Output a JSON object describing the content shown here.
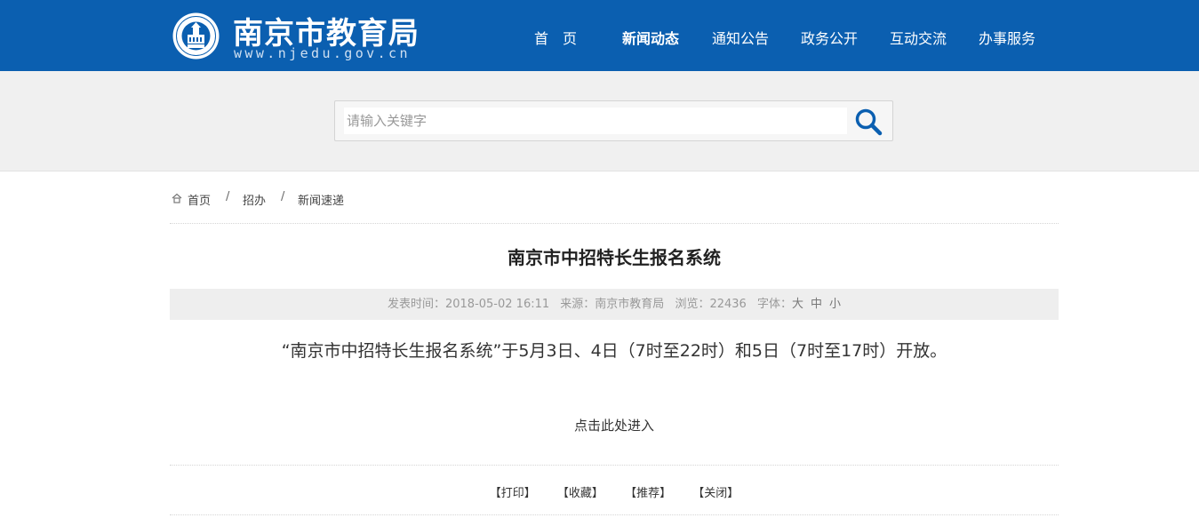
{
  "header": {
    "site_title": "南京市教育局",
    "site_url": "www.njedu.gov.cn",
    "logo_icon": "nanjing-education-emblem-icon",
    "nav": [
      {
        "label": "首　页",
        "active": false
      },
      {
        "label": "新闻动态",
        "active": true
      },
      {
        "label": "通知公告",
        "active": false
      },
      {
        "label": "政务公开",
        "active": false
      },
      {
        "label": "互动交流",
        "active": false
      },
      {
        "label": "办事服务",
        "active": false
      }
    ],
    "brand_color": "#0b5fb0"
  },
  "search": {
    "placeholder": "请输入关键字",
    "value": "",
    "button_icon": "search-icon"
  },
  "breadcrumb": {
    "icon": "home-icon",
    "items": [
      "首页",
      "招办",
      "新闻速递"
    ],
    "separator": "/"
  },
  "article": {
    "title": "南京市中招特长生报名系统",
    "meta": {
      "publish_time": "发表时间：2018-05-02 16:11",
      "source": "来源：南京市教育局",
      "views": "浏览：22436",
      "font_label": "字体：",
      "font_large": "大",
      "font_medium": "中",
      "font_small": "小"
    },
    "body": "“南京市中招特长生报名系统”于5月3日、4日（7时至22时）和5日（7时至17时）开放。",
    "enter_link": "点击此处进入"
  },
  "actions": {
    "print": "【打印】",
    "favorite": "【收藏】",
    "recommend": "【推荐】",
    "close": "【关闭】"
  }
}
